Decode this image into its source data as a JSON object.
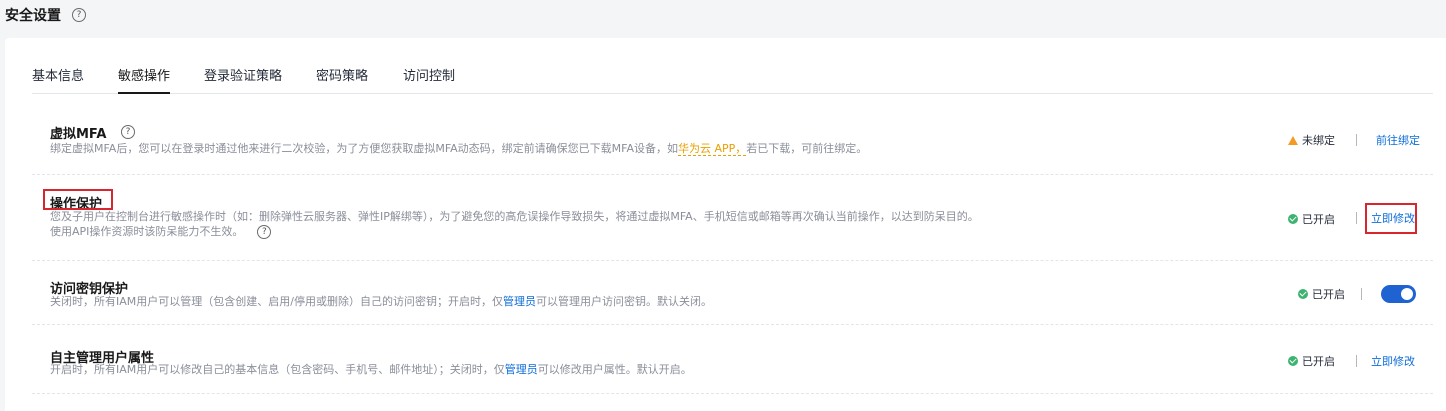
{
  "header": {
    "title": "安全设置",
    "help_icon": "question-circle-icon"
  },
  "tabs": [
    {
      "label": "基本信息",
      "active": false
    },
    {
      "label": "敏感操作",
      "active": true
    },
    {
      "label": "登录验证策略",
      "active": false
    },
    {
      "label": "密码策略",
      "active": false
    },
    {
      "label": "访问控制",
      "active": false
    }
  ],
  "rows": {
    "mfa": {
      "title": "虚拟MFA",
      "desc_prefix": "绑定虚拟MFA后，您可以在登录时通过他来进行二次校验，为了方便您获取虚拟MFA动态码，绑定前请确保您已下载MFA设备，如",
      "desc_link": "华为云 APP，",
      "desc_suffix": "若已下载，可前往绑定。",
      "status": "未绑定",
      "status_icon": "warning-triangle-icon",
      "action": "前往绑定"
    },
    "op_protect": {
      "title": "操作保护",
      "desc_line1": "您及子用户在控制台进行敏感操作时（如：删除弹性云服务器、弹性IP解绑等），为了避免您的高危误操作导致损失，将通过虚拟MFA、手机短信或邮箱等再次确认当前操作，以达到防呆目的。",
      "desc_line2": "使用API操作资源时该防呆能力不生效。",
      "status": "已开启",
      "status_icon": "check-circle-icon",
      "action": "立即修改"
    },
    "access_key": {
      "title": "访问密钥保护",
      "desc_prefix": "关闭时，所有IAM用户可以管理（包含创建、启用/停用或删除）自己的访问密钥；开启时，仅",
      "desc_link": "管理员",
      "desc_suffix": "可以管理用户访问密钥。默认关闭。",
      "status": "已开启",
      "status_icon": "check-circle-icon",
      "toggle_on": true
    },
    "self_manage": {
      "title": "自主管理用户属性",
      "desc_prefix": "开启时，所有IAM用户可以修改自己的基本信息（包含密码、手机号、邮件地址）；关闭时，仅",
      "desc_link": "管理员",
      "desc_suffix": "可以修改用户属性。默认开启。",
      "status": "已开启",
      "status_icon": "check-circle-icon",
      "action": "立即修改"
    }
  },
  "colors": {
    "accent": "#1f63d3",
    "link": "#0d6cd9",
    "ok": "#3cb371",
    "warn": "#f59a23",
    "highlight_box": "#d7262d"
  }
}
